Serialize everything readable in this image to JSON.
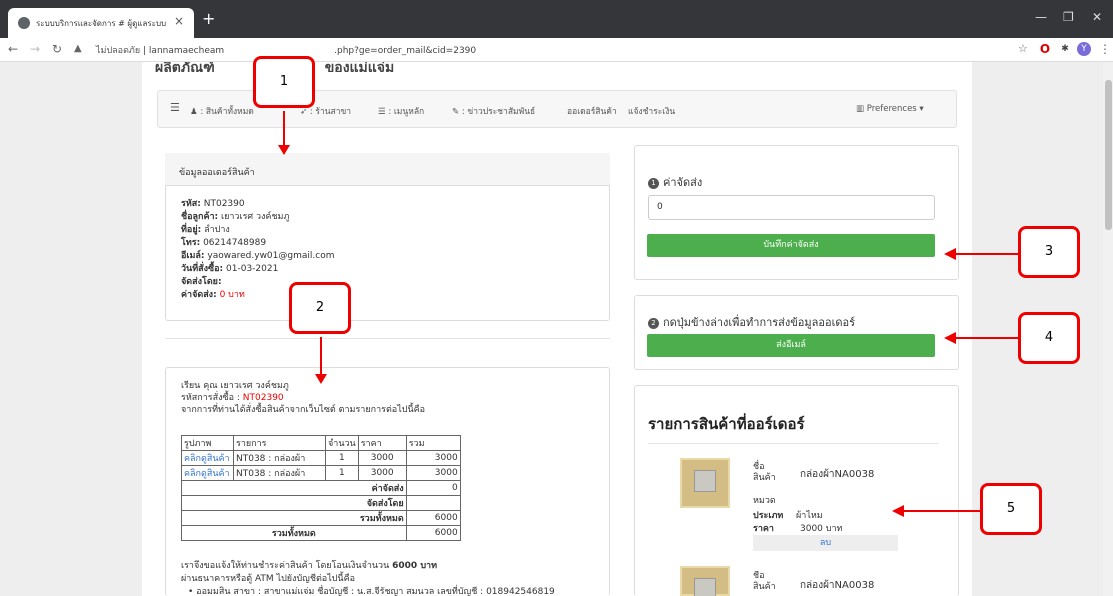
{
  "browser": {
    "tab_title": "ระบบบริการและจัดการ # ผู้ดูแลระบบ",
    "url_warning": "ไม่ปลอดภัย",
    "url": "lannamaecheam",
    "url_tail": ".php?ge=order_mail&cid=2390",
    "minimize": "—",
    "maximize": "❐",
    "close": "✕"
  },
  "page": {
    "site_title": "ผลิตภัณฑ์",
    "site_title_tail": "ของแม่แจ่ม"
  },
  "navbar": {
    "items": [
      "สินค้าทั้งหมด",
      "ร้านสาขา",
      "เมนูหลัก",
      "ข่าวประชาสัมพันธ์",
      "ออเดอร์สินค้า",
      "แจ้งชำระเงิน"
    ],
    "preferences": "Preferences"
  },
  "info": {
    "heading": "ข้อมูลออเดอร์สินค้า",
    "code_label": "รหัส:",
    "code": "NT02390",
    "customer_label": "ชื่อลูกค้า:",
    "customer": "เยาวเรศ วงค์ชมภู",
    "address_label": "ที่อยู่:",
    "address": "ลำปาง",
    "phone_label": "โทร:",
    "phone": "06214748989",
    "email_label": "อีเมล์:",
    "email": "yaowared.yw01@gmail.com",
    "date_label": "วันที่สั่งซื้อ:",
    "date": "01-03-2021",
    "ship_by_label": "จัดส่งโดย:",
    "ship_cost_label": "ค่าจัดส่ง:",
    "ship_cost": "0 บาท"
  },
  "mail": {
    "greeting": "เรียน คุณ เยาวเรศ วงค์ชมภู",
    "order_code_label": "รหัสการสั่งซื้อ :",
    "order_code": "NT02390",
    "intro": "จากการที่ท่านได้สั่งซื้อสินค้าจากเว็บไซต์ ตามรายการต่อไปนี้คือ",
    "headers": [
      "รูปภาพ",
      "รายการ",
      "จำนวน",
      "ราคา",
      "รวม"
    ],
    "rows": [
      {
        "link": "คลิกดูสินค้า",
        "item": "NT038 : กล่องผ้า",
        "qty": "1",
        "price": "3000",
        "total": "3000"
      },
      {
        "link": "คลิกดูสินค้า",
        "item": "NT038 : กล่องผ้า",
        "qty": "1",
        "price": "3000",
        "total": "3000"
      }
    ],
    "ship_label": "ค่าจัดส่ง",
    "ship_value": "0",
    "ship_by_label": "จัดส่งโดย",
    "sum_label": "รวมทั้งหมด",
    "sum_value": "6000",
    "grand_label": "รวมทั้งหมด",
    "grand_value": "6000",
    "pay_line": "เราจึงขอแจ้งให้ท่านชำระค่าสินค้า โดยโอนเงินจำนวน",
    "pay_amount": "6000 บาท",
    "bank_line": "ผ่านธนาคารหรือตู้ ATM ไปยังบัญชีต่อไปนี้คือ",
    "bank_item": "• ออมมสิน สาขา : สาขาแม่แจ่ม ชื่อบัญชี : น.ส.จีรัชญา สมนวล เลขที่บัญชี : 018942546819"
  },
  "shipping": {
    "step": "1",
    "title": "ค่าจัดส่ง",
    "value": "0",
    "save_button": "บันทึกค่าจัดส่ง"
  },
  "send": {
    "step": "2",
    "title": "กดปุ่มข้างล่างเพื่อทำการส่งข้อมูลออเดอร์",
    "button": "ส่งอีเมล์"
  },
  "products": {
    "heading": "รายการสินค้าที่ออร์เดอร์",
    "items": [
      {
        "name_label": "ชื่อ\nสินค้า",
        "name": "กล่องผ้าNA0038",
        "cat_label": "หมวด",
        "type_label": "ประเภท",
        "type": "ผ้าไหม",
        "price_label": "ราคา",
        "price": "3000 บาท",
        "delete": "ลบ"
      },
      {
        "name_label": "ชื่อ\nสินค้า",
        "name": "กล่องผ้าNA0038"
      }
    ]
  },
  "callouts": [
    "1",
    "2",
    "3",
    "4",
    "5"
  ],
  "colors": {
    "accent_green": "#4cae4c",
    "callout_red": "#e00000",
    "link_blue": "#3173d0"
  }
}
